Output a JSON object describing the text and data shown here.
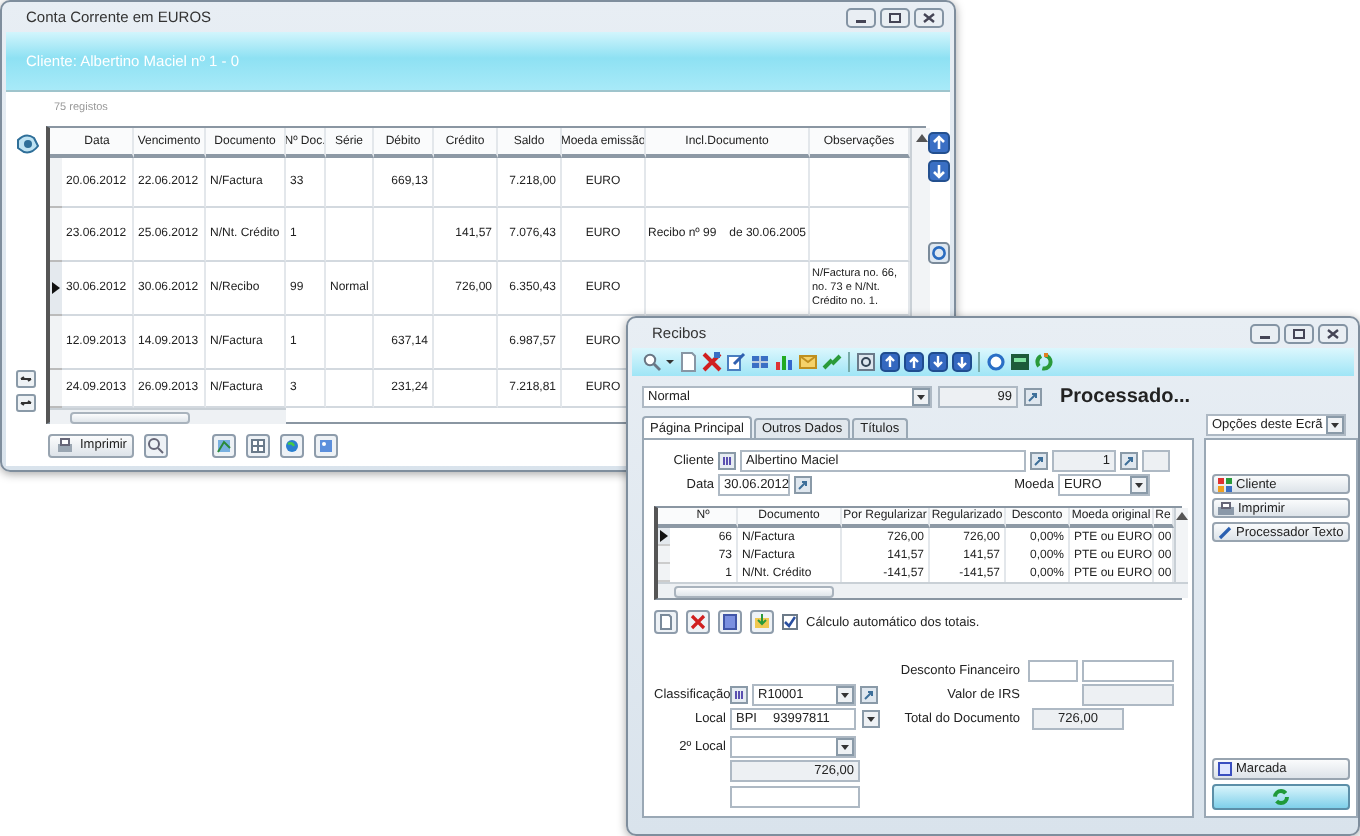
{
  "ledger_window": {
    "title": "Conta Corrente em EUROS",
    "client_banner": "Cliente: Albertino Maciel nº 1 - 0",
    "record_count": "75 registos",
    "table": {
      "columns": [
        "Data",
        "Vencimento",
        "Documento",
        "Nº Doc.",
        "Série",
        "Débito",
        "Crédito",
        "Saldo",
        "Moeda emissão",
        "Incl.Documento",
        "Observações"
      ],
      "rows": [
        {
          "selected": false,
          "cells": [
            "20.06.2012",
            "22.06.2012",
            "N/Factura",
            "33",
            null,
            "669,13",
            null,
            "7.218,00",
            "EURO",
            null,
            null
          ]
        },
        {
          "selected": false,
          "cells": [
            "23.06.2012",
            "25.06.2012",
            "N/Nt. Crédito",
            "1",
            null,
            null,
            "141,57",
            "7.076,43",
            "EURO",
            [
              "Recibo nº 99",
              "de 30.06.2005"
            ],
            null
          ]
        },
        {
          "selected": true,
          "cells": [
            "30.06.2012",
            "30.06.2012",
            "N/Recibo",
            "99",
            "Normal",
            null,
            "726,00",
            "6.350,43",
            "EURO",
            null,
            "N/Factura no. 66, no. 73 e N/Nt. Crédito no. 1."
          ]
        },
        {
          "selected": false,
          "cells": [
            "12.09.2013",
            "14.09.2013",
            "N/Factura",
            "1",
            null,
            "637,14",
            null,
            "6.987,57",
            "EURO"
          ]
        },
        {
          "selected": false,
          "cells": [
            "24.09.2013",
            "26.09.2013",
            "N/Factura",
            "3",
            null,
            "231,24",
            null,
            "7.218,81",
            "EURO"
          ]
        }
      ]
    },
    "print_button": "Imprimir"
  },
  "receipts_window": {
    "title": "Recibos",
    "series": "Normal",
    "number": "99",
    "status": "Processado...",
    "tabs": [
      {
        "label": "Página Principal",
        "selected": true
      },
      {
        "label": "Outros Dados",
        "selected": false
      },
      {
        "label": "Títulos",
        "selected": false
      }
    ],
    "screen_options": "Opções deste Ecrã",
    "client": {
      "label": "Cliente",
      "name": "Albertino Maciel",
      "number": "1"
    },
    "date": {
      "label": "Data",
      "value": "30.06.2012"
    },
    "currency": {
      "label": "Moeda",
      "value": "EURO"
    },
    "lines": {
      "columns": [
        "Nº",
        "Documento",
        "Por Regularizar",
        "Regularizado",
        "Desconto",
        "Moeda original",
        "Re"
      ],
      "rows": [
        {
          "selected": true,
          "cells": [
            "66",
            "N/Factura",
            "726,00",
            "726,00",
            "0,00%",
            "PTE ou EURO",
            "00"
          ]
        },
        {
          "selected": false,
          "cells": [
            "73",
            "N/Factura",
            "141,57",
            "141,57",
            "0,00%",
            "PTE ou EURO",
            "00"
          ]
        },
        {
          "selected": false,
          "cells": [
            "1",
            "N/Nt. Crédito",
            "-141,57",
            "-141,57",
            "0,00%",
            "PTE ou EURO",
            "00"
          ]
        }
      ]
    },
    "auto_totals": {
      "label": "Cálculo automático dos totais.",
      "checked": true
    },
    "classification": {
      "label": "Classificação",
      "value": "R10001"
    },
    "location": {
      "label": "Local",
      "bank": "BPI",
      "account": "93997811"
    },
    "second_location": {
      "label": "2º Local"
    },
    "amount": "726,00",
    "financial_discount": {
      "label": "Desconto Financeiro"
    },
    "irs_value": {
      "label": "Valor de IRS"
    },
    "document_total": {
      "label": "Total do Documento",
      "value": "726,00"
    },
    "side_buttons": [
      "Cliente",
      "Imprimir",
      "Processador Texto"
    ],
    "marked_button": "Marcada"
  }
}
